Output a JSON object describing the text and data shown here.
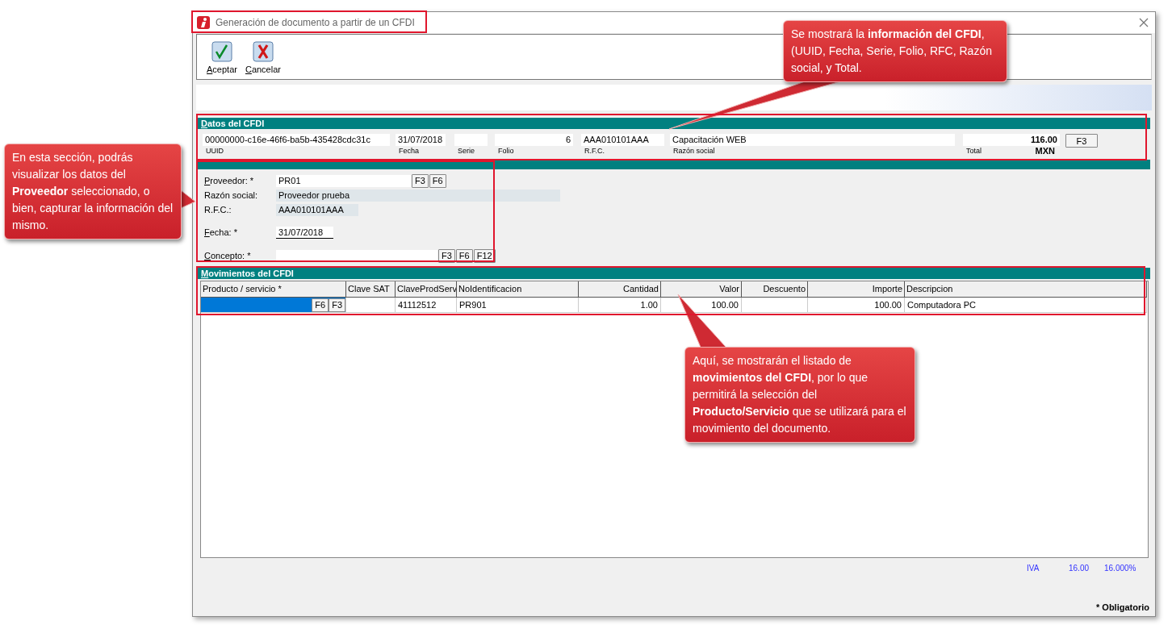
{
  "window": {
    "title": "Generación de documento a partir de un CFDI"
  },
  "toolbar": [
    {
      "label": "Aceptar",
      "kind": "accept",
      "mnemonic": true
    },
    {
      "label": "Cancelar",
      "kind": "cancel",
      "mnemonic": true
    }
  ],
  "cfdi": {
    "header": "Datos del CFDI",
    "mnemonic": true,
    "fields": [
      {
        "label": "UUID",
        "value": "00000000-c16e-46f6-ba5b-435428cdc31c"
      },
      {
        "label": "Fecha",
        "value": "31/07/2018"
      },
      {
        "label": "Serie"
      },
      {
        "label": "Folio",
        "value": "6"
      },
      {
        "label": "R.F.C.",
        "value": "AAA010101AAA"
      },
      {
        "label": "Razón social",
        "value": "Capacitación WEB"
      }
    ],
    "total": {
      "label": "Total",
      "value": "116.00",
      "currency": "MXN"
    },
    "button": "F3"
  },
  "proveedor": [
    {
      "label": "Proveedor: *",
      "kind": "input",
      "mnemonic": true,
      "value": "PR01",
      "buttons": [
        "F3",
        "F6"
      ]
    },
    {
      "label": "Razón social:",
      "kind": "readonly",
      "mnemonic": false,
      "value": "Proveedor prueba"
    },
    {
      "label": "R.F.C.:",
      "kind": "readonly",
      "mnemonic": false,
      "value": "AAA010101AAA"
    },
    {
      "label": "Fecha: *",
      "kind": "date",
      "mnemonic": true,
      "value": "31/07/2018"
    },
    {
      "label": "Concepto: *",
      "kind": "input",
      "mnemonic": true,
      "buttons": [
        "F3",
        "F6",
        "F12"
      ]
    }
  ],
  "movimientos": {
    "header": "Movimientos del CFDI",
    "mnemonic": true,
    "columns": [
      "Producto / servicio *",
      "Clave SAT",
      "ClaveProdServ",
      "NoIdentificacion",
      "Cantidad",
      "Valor",
      "Descuento",
      "Importe",
      "Descripcion"
    ],
    "rows": [
      {
        "cells": [
          {
            "selected": true,
            "buttons": [
              "F6",
              "F3"
            ]
          },
          {
            "selected": false
          },
          {
            "text": "41112512",
            "selected": false
          },
          {
            "text": "PR901",
            "selected": false
          },
          {
            "text": "1.00",
            "selected": false
          },
          {
            "text": "100.00",
            "selected": false
          },
          {
            "selected": false
          },
          {
            "text": "100.00",
            "selected": false
          },
          {
            "text": "Computadora PC",
            "selected": false
          }
        ]
      }
    ]
  },
  "taxes": [
    {
      "name": "IVA",
      "amount": "16.00",
      "rate": "16.000%"
    }
  ],
  "footer": "* Obligatorio",
  "callouts": [
    {
      "text": "Se mostrará la **información del CFDI**, (UUID, Fecha, Serie, Folio, RFC, Razón social, y Total."
    },
    {
      "text": "En esta sección, podrás visualizar los datos del **Proveedor** seleccionado, o bien, capturar la información del mismo."
    },
    {
      "text": "Aquí, se mostrarán el listado de **movimientos del CFDI**, por lo que permitirá la selección del **Producto/Servicio** que se utilizará para el movimiento del documento."
    }
  ]
}
